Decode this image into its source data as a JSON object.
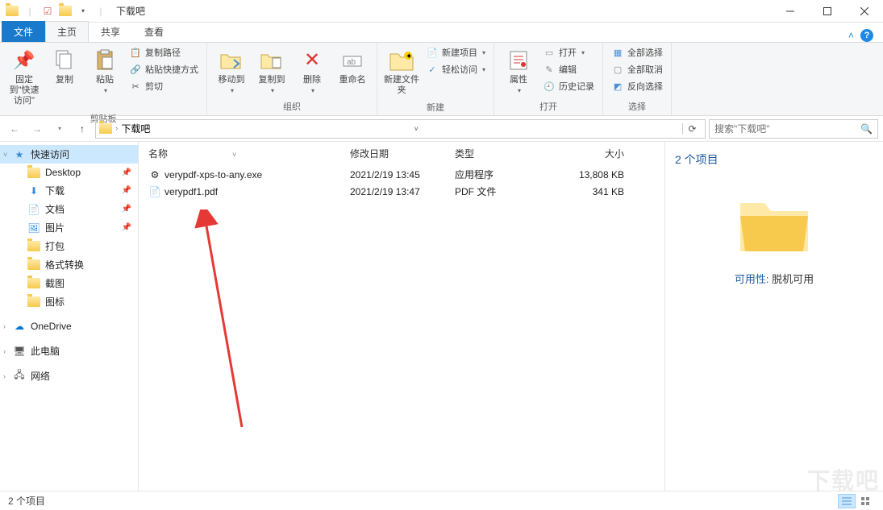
{
  "title": "下载吧",
  "tabs": {
    "file": "文件",
    "home": "主页",
    "share": "共享",
    "view": "查看"
  },
  "ribbon": {
    "pin": "固定到\"快速访问\"",
    "copy": "复制",
    "paste": "粘贴",
    "copypath": "复制路径",
    "pasteshortcut": "粘贴快捷方式",
    "cut": "剪切",
    "clipboard_group": "剪贴板",
    "moveto": "移动到",
    "copyto": "复制到",
    "delete": "删除",
    "rename": "重命名",
    "organize_group": "组织",
    "newfolder": "新建文件夹",
    "newitem": "新建项目",
    "easyaccess": "轻松访问",
    "new_group": "新建",
    "properties": "属性",
    "open": "打开",
    "edit": "编辑",
    "history": "历史记录",
    "open_group": "打开",
    "selectall": "全部选择",
    "selectnone": "全部取消",
    "invertsel": "反向选择",
    "select_group": "选择"
  },
  "address": {
    "folder": "下载吧"
  },
  "search": {
    "placeholder": "搜索\"下载吧\""
  },
  "sidebar": {
    "quick": "快速访问",
    "desktop": "Desktop",
    "downloads": "下载",
    "documents": "文档",
    "pictures": "图片",
    "pack": "打包",
    "convert": "格式转换",
    "screenshot": "截图",
    "icons": "图标",
    "onedrive": "OneDrive",
    "thispc": "此电脑",
    "network": "网络"
  },
  "columns": {
    "name": "名称",
    "date": "修改日期",
    "type": "类型",
    "size": "大小"
  },
  "files": [
    {
      "name": "verypdf-xps-to-any.exe",
      "date": "2021/2/19 13:45",
      "type": "应用程序",
      "size": "13,808 KB"
    },
    {
      "name": "verypdf1.pdf",
      "date": "2021/2/19 13:47",
      "type": "PDF 文件",
      "size": "341 KB"
    }
  ],
  "preview": {
    "count": "2 个项目",
    "avail_label": "可用性:",
    "avail_value": "脱机可用"
  },
  "status": {
    "count": "2 个项目"
  }
}
